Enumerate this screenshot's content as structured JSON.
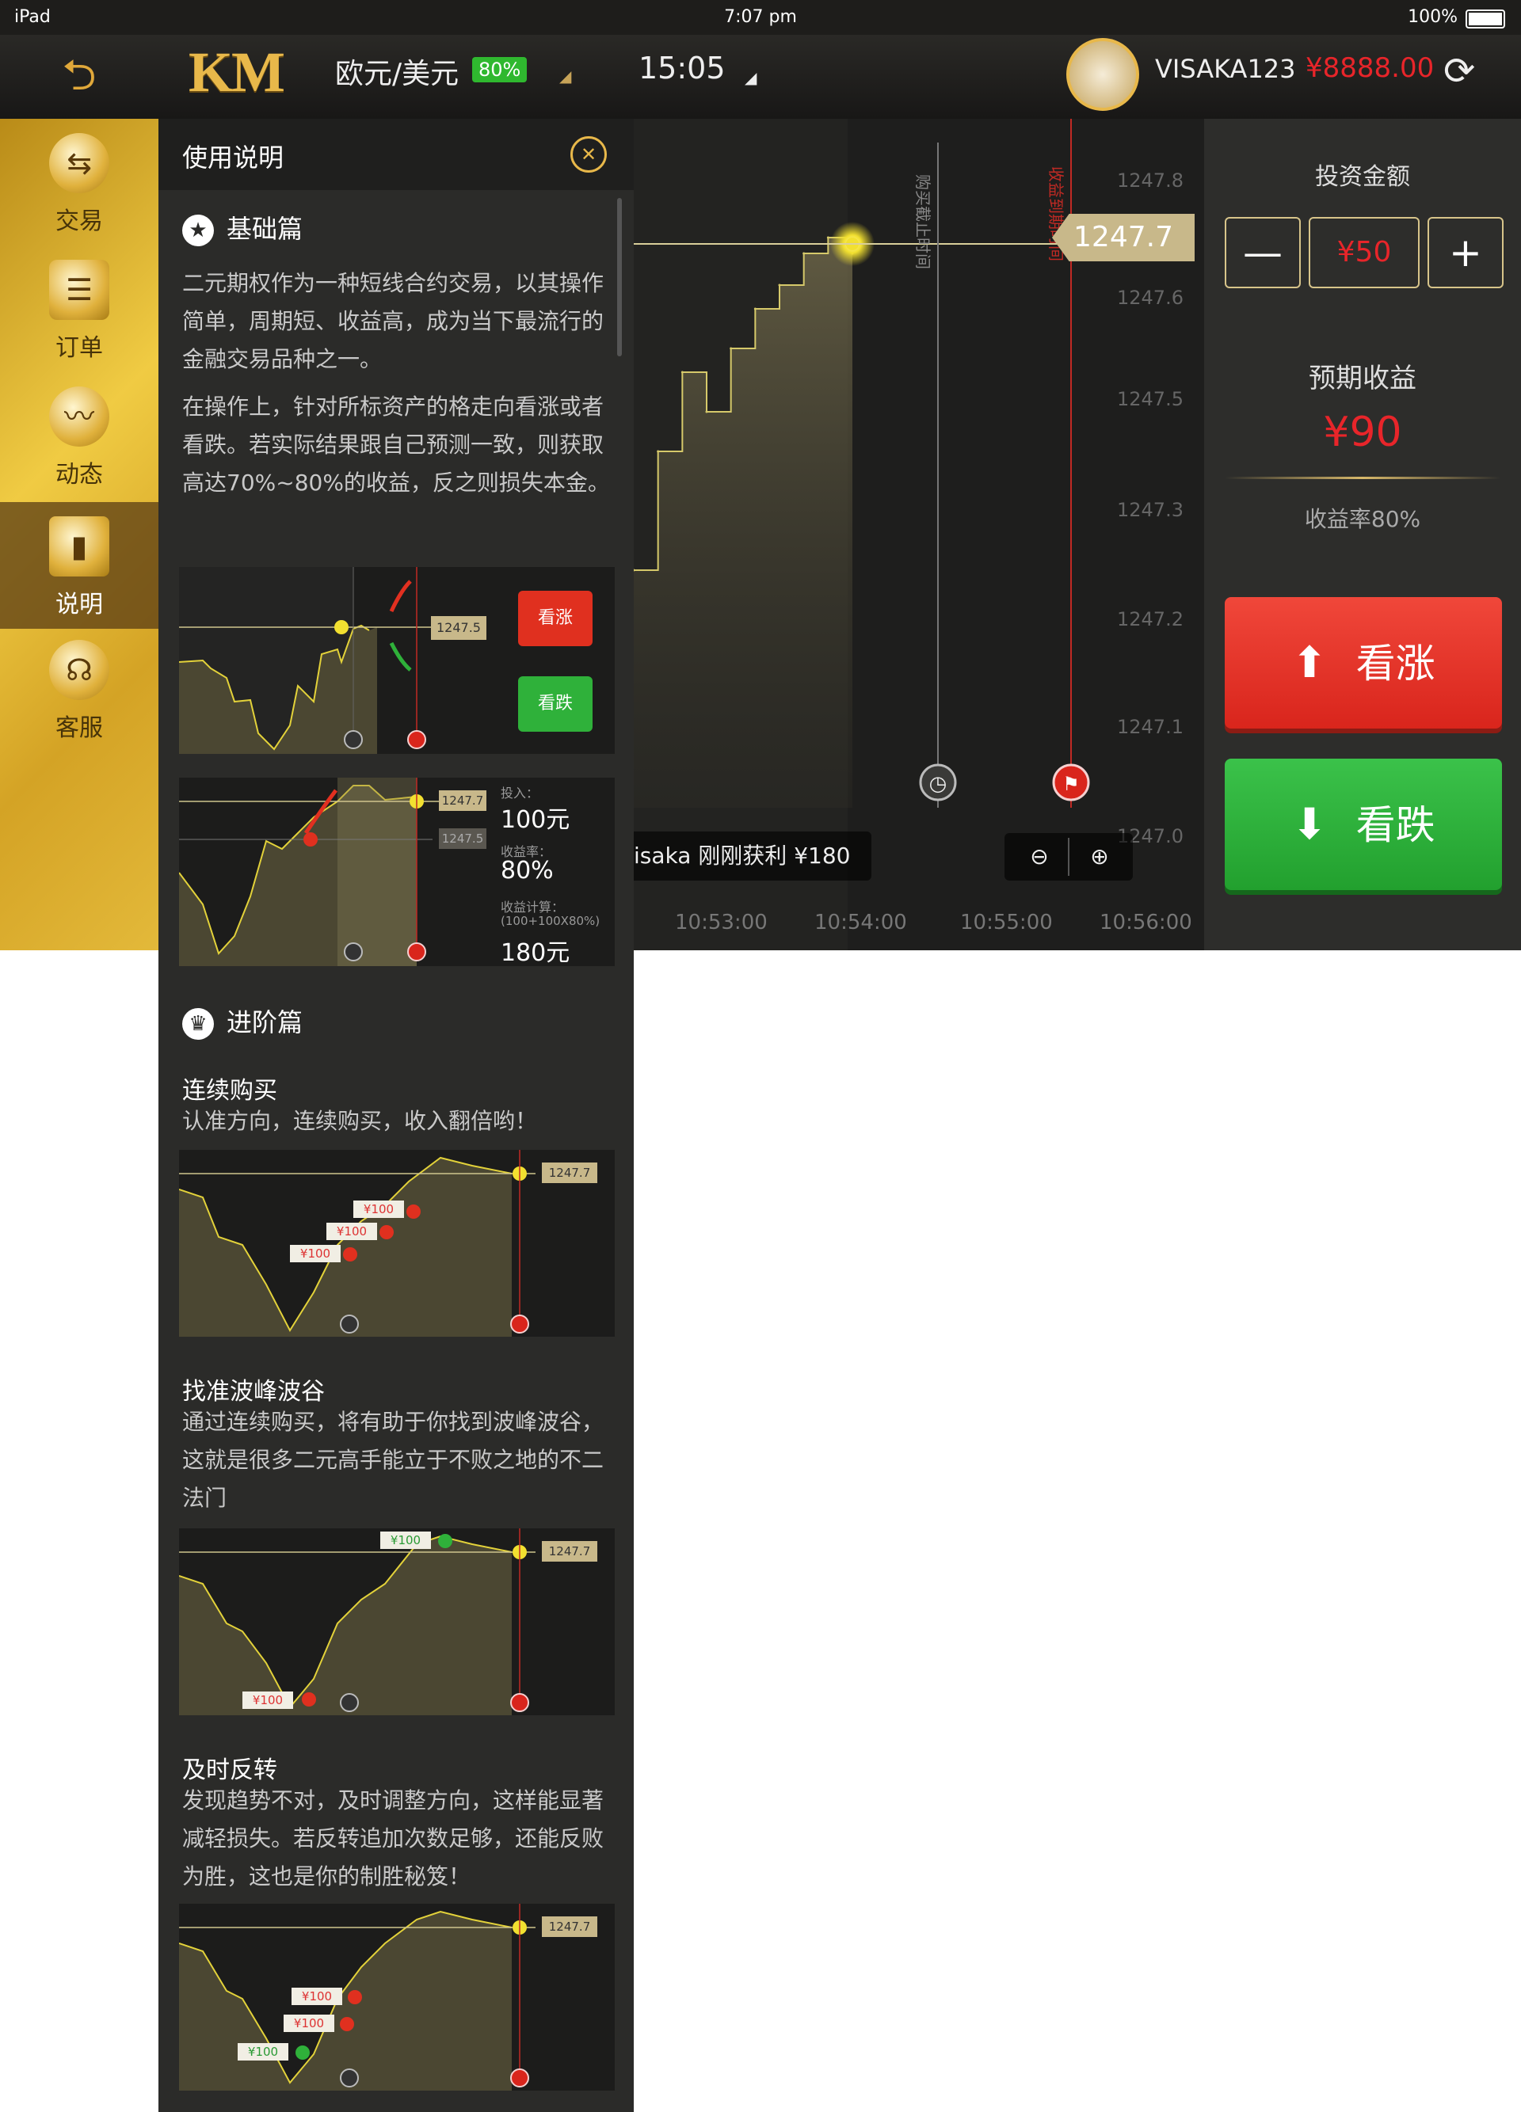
{
  "status_bar": {
    "device": "iPad",
    "time": "7:07 pm",
    "battery": "100%"
  },
  "topbar": {
    "logo": "KM",
    "asset": "欧元/美元",
    "payout_badge": "80%",
    "timer": "15:05",
    "username": "VISAKA123",
    "balance": "¥8888.00"
  },
  "sidebar": {
    "items": [
      {
        "label": "交易",
        "icon": "exchange-icon"
      },
      {
        "label": "订单",
        "icon": "list-icon"
      },
      {
        "label": "动态",
        "icon": "trend-icon"
      },
      {
        "label": "说明",
        "icon": "book-icon",
        "active": true
      },
      {
        "label": "客服",
        "icon": "headset-icon"
      }
    ]
  },
  "help": {
    "title": "使用说明",
    "basic": {
      "title": "基础篇",
      "p1": "二元期权作为一种短线合约交易，以其操作简单，周期短、收益高，成为当下最流行的金融交易品种之一。",
      "p2": "在操作上，针对所标资产的格走向看涨或者看跌。若实际结果跟自己预测一致，则获取高达70%~80%的收益，反之则损失本金。",
      "illus1": {
        "tag": "1247.5",
        "up_label": "看涨",
        "down_label": "看跌"
      },
      "illus2": {
        "tag1": "1247.7",
        "tag2": "1247.5",
        "invest_label": "投入：",
        "invest_value": "100元",
        "rate_label": "收益率：",
        "rate_value": "80%",
        "calc_label": "收益计算：",
        "calc_formula": "(100+100X80%)",
        "calc_value": "180元"
      }
    },
    "advanced": {
      "title": "进阶篇",
      "s1_title": "连续购买",
      "s1_text": "认准方向，连续购买，收入翻倍哟！",
      "s2_title": "找准波峰波谷",
      "s2_text": "通过连续购买，将有助于你找到波峰波谷，这就是很多二元高手能立于不败之地的不二法门",
      "s3_title": "及时反转",
      "s3_text": "发现趋势不对，及时调整方向，这样能显著减轻损失。若反转追加次数足够，还能反败为胜，这也是你的制胜秘笈！",
      "tag": "1247.7",
      "order_label": "¥100"
    }
  },
  "chart": {
    "price_tag": "1247.7",
    "buy_deadline_label": "购买截止时间",
    "expiry_label": "收益到期时间",
    "notification": "isaka 刚刚获利 ¥180",
    "y_ticks": [
      "1247.8",
      "1247.6",
      "1247.5",
      "1247.3",
      "1247.2",
      "1247.1",
      "1247.0"
    ],
    "x_ticks": [
      "10:53:00",
      "10:54:00",
      "10:55:00",
      "10:56:00"
    ]
  },
  "chart_data": {
    "type": "line",
    "title": "",
    "xlabel": "",
    "ylabel": "",
    "x": [
      "10:52:40",
      "10:52:50",
      "10:53:00",
      "10:53:10",
      "10:53:20",
      "10:53:30",
      "10:53:40",
      "10:53:50",
      "10:54:00",
      "10:54:05"
    ],
    "values": [
      1247.3,
      1247.45,
      1247.55,
      1247.5,
      1247.58,
      1247.63,
      1247.66,
      1247.7,
      1247.72,
      1247.7
    ],
    "ylim": [
      1247.0,
      1247.8
    ],
    "grid": false
  },
  "trade_panel": {
    "invest_label": "投资金额",
    "minus": "—",
    "amount": "¥50",
    "plus": "+",
    "expected_label": "预期收益",
    "expected_value": "¥90",
    "rate_text": "收益率80%",
    "up_label": "看涨",
    "down_label": "看跌"
  },
  "colors": {
    "gold": "#e8b84a",
    "up_red": "#e0301f",
    "down_green": "#2fb13a",
    "price_red": "#e8252a"
  }
}
